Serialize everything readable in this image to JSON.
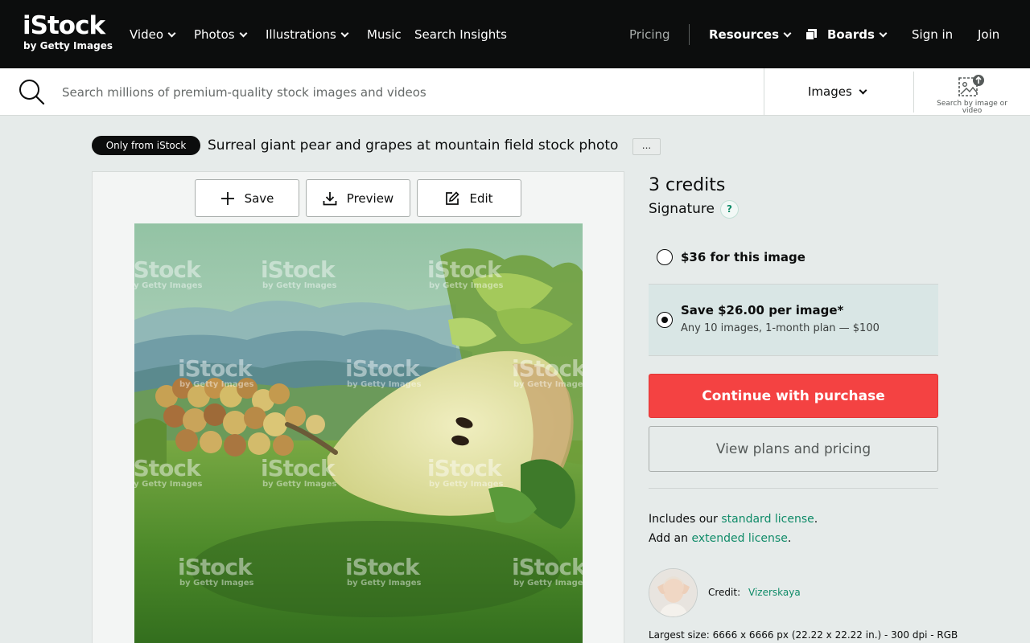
{
  "header": {
    "logo_main": "iStock",
    "logo_sub": "by Getty Images",
    "nav": [
      {
        "label": "Video"
      },
      {
        "label": "Photos"
      },
      {
        "label": "Illustrations"
      },
      {
        "label": "Music"
      },
      {
        "label": "Search Insights"
      }
    ],
    "pricing": "Pricing",
    "resources": "Resources",
    "boards": "Boards",
    "sign_in": "Sign in",
    "join": "Join"
  },
  "search": {
    "placeholder": "Search millions of premium-quality stock images and videos",
    "value": "",
    "type": "Images",
    "by_image_label": "Search by image or video"
  },
  "asset": {
    "badge": "Only from iStock",
    "title": "Surreal giant pear and grapes at mountain field stock photo",
    "more_label": "...",
    "actions": {
      "save": "Save",
      "preview": "Preview",
      "edit": "Edit"
    },
    "watermark_main": "iStock",
    "watermark_sub": "by Getty Images"
  },
  "purchase": {
    "credits": "3 credits",
    "tier": "Signature",
    "help": "?",
    "options": [
      {
        "label": "$36 for this image",
        "sub": "",
        "selected": false
      },
      {
        "label": "Save $26.00 per image*",
        "sub": "Any 10 images, 1-month plan — $100",
        "selected": true
      }
    ],
    "cta": "Continue with purchase",
    "plans": "View plans and pricing",
    "license_line1_prefix": "Includes our ",
    "license_line1_link": "standard license",
    "license_line1_suffix": ".",
    "license_line2_prefix": "Add an ",
    "license_line2_link": "extended license",
    "license_line2_suffix": ".",
    "credit_label": "Credit:",
    "credit_name": "Vizerskaya",
    "largest_size": "Largest size: 6666 x 6666 px (22.22 x 22.22 in.) - 300 dpi - RGB"
  },
  "colors": {
    "accent": "#f44242",
    "link": "#0f8b68",
    "topbar": "#0c0d0d",
    "page_bg": "#e6ebea",
    "selected_option_bg": "#d9e6e5"
  }
}
